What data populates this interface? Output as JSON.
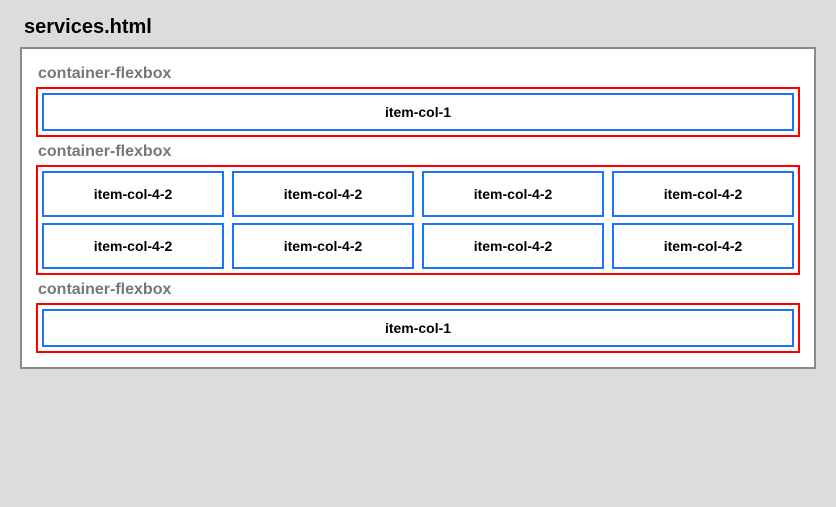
{
  "page_title": "services.html",
  "sections": [
    {
      "label": "container-flexbox",
      "items": [
        {
          "label": "item-col-1",
          "cls": "col-1"
        }
      ]
    },
    {
      "label": "container-flexbox",
      "items": [
        {
          "label": "item-col-4-2",
          "cls": "col-4-2"
        },
        {
          "label": "item-col-4-2",
          "cls": "col-4-2"
        },
        {
          "label": "item-col-4-2",
          "cls": "col-4-2"
        },
        {
          "label": "item-col-4-2",
          "cls": "col-4-2"
        },
        {
          "label": "item-col-4-2",
          "cls": "col-4-2"
        },
        {
          "label": "item-col-4-2",
          "cls": "col-4-2"
        },
        {
          "label": "item-col-4-2",
          "cls": "col-4-2"
        },
        {
          "label": "item-col-4-2",
          "cls": "col-4-2"
        }
      ]
    },
    {
      "label": "container-flexbox",
      "items": [
        {
          "label": "item-col-1",
          "cls": "col-1"
        }
      ]
    }
  ]
}
